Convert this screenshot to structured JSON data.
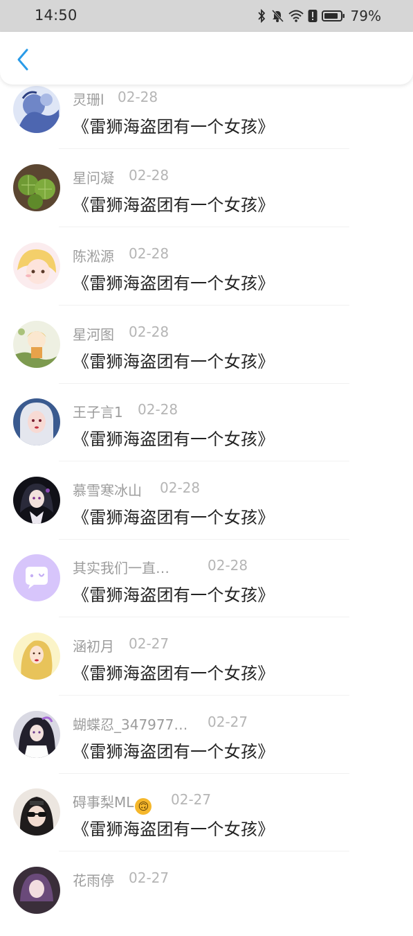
{
  "status_bar": {
    "time": "14:50",
    "battery_percent": "79%",
    "icons": [
      "bluetooth-icon",
      "mute-bell-icon",
      "wifi-icon",
      "alert-icon",
      "battery-icon"
    ]
  },
  "nav": {
    "back_icon": "chevron-left-icon",
    "accent": "#2a9be8"
  },
  "items": [
    {
      "name": "灵珊l",
      "date": "02-28",
      "title": "《雷狮海盗团有一个女孩》",
      "avatar": "anime-blue-sketch"
    },
    {
      "name": "星问凝",
      "date": "02-28",
      "title": "《雷狮海盗团有一个女孩》",
      "avatar": "cactus"
    },
    {
      "name": "陈淞源",
      "date": "02-28",
      "title": "《雷狮海盗团有一个女孩》",
      "avatar": "anime-blonde-girl"
    },
    {
      "name": "星河图",
      "date": "02-28",
      "title": "《雷狮海盗团有一个女孩》",
      "avatar": "anime-character-green"
    },
    {
      "name": "王子言1",
      "date": "02-28",
      "title": "《雷狮海盗团有一个女孩》",
      "avatar": "anime-white-hair"
    },
    {
      "name": "慕雪寒冰山",
      "date": "02-28",
      "title": "《雷狮海盗团有一个女孩》",
      "avatar": "anime-dark-character"
    },
    {
      "name": "其实我们一直…",
      "date": "02-28",
      "title": "《雷狮海盗团有一个女孩》",
      "avatar": "default-chat-bubble"
    },
    {
      "name": "涵初月",
      "date": "02-27",
      "title": "《雷狮海盗团有一个女孩》",
      "avatar": "blonde-girl-illustration"
    },
    {
      "name": "蝴蝶忍_347977…",
      "date": "02-27",
      "title": "《雷狮海盗团有一个女孩》",
      "avatar": "anime-dark-hair-girl"
    },
    {
      "name": "碍事梨ML",
      "date": "02-27",
      "title": "《雷狮海盗团有一个女孩》",
      "avatar": "girl-with-sunglasses",
      "emoji": "🙃"
    },
    {
      "name": "花雨停",
      "date": "02-27",
      "title": "",
      "avatar": "anime-purple-hair"
    }
  ]
}
